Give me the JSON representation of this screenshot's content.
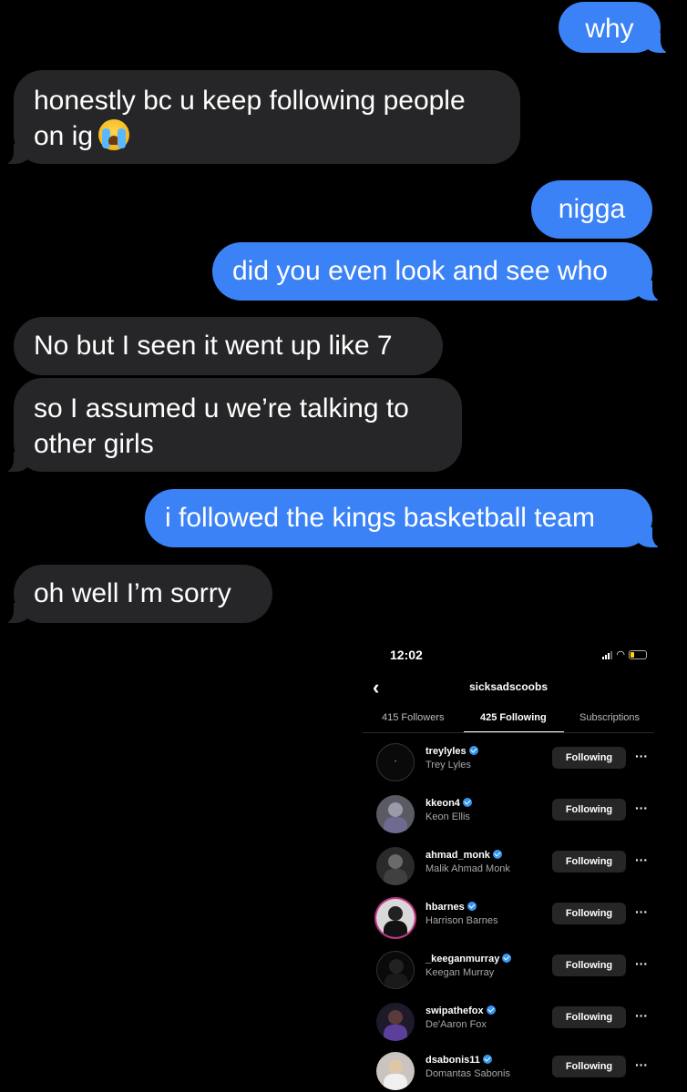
{
  "messages": [
    {
      "from": "me",
      "text": "why"
    },
    {
      "from": "them",
      "text": "honestly bc u keep following people on ig",
      "emoji": "loudly-crying-face"
    },
    {
      "from": "me",
      "text": "nigga"
    },
    {
      "from": "me",
      "text": "did you even look and see who"
    },
    {
      "from": "them",
      "text": "No but I seen it went up like 7"
    },
    {
      "from": "them",
      "text": "so I assumed u we’re talking to other girls"
    },
    {
      "from": "me",
      "text": "i followed the kings basketball team"
    },
    {
      "from": "them",
      "text": "oh well I’m sorry"
    }
  ],
  "screenshot": {
    "status_time": "12:02",
    "profile_username": "sicksadscoobs",
    "tabs": [
      "415 Followers",
      "425 Following",
      "Subscriptions"
    ],
    "active_tab": "425 Following",
    "button_label": "Following",
    "more_label": "···",
    "following": [
      {
        "username": "treylyles",
        "name": "Trey Lyles",
        "verified": true
      },
      {
        "username": "kkeon4",
        "name": "Keon Ellis",
        "verified": true
      },
      {
        "username": "ahmad_monk",
        "name": "Malik Ahmad Monk",
        "verified": true
      },
      {
        "username": "hbarnes",
        "name": "Harrison Barnes",
        "verified": true
      },
      {
        "username": "_keeganmurray",
        "name": "Keegan Murray",
        "verified": true
      },
      {
        "username": "swipathefox",
        "name": "De'Aaron Fox",
        "verified": true
      },
      {
        "username": "dsabonis11",
        "name": "Domantas Sabonis",
        "verified": true
      }
    ]
  },
  "colors": {
    "outgoing_bubble": "#3b82f6",
    "incoming_bubble": "#262628",
    "background": "#000000",
    "verified_badge": "#3897f0"
  }
}
